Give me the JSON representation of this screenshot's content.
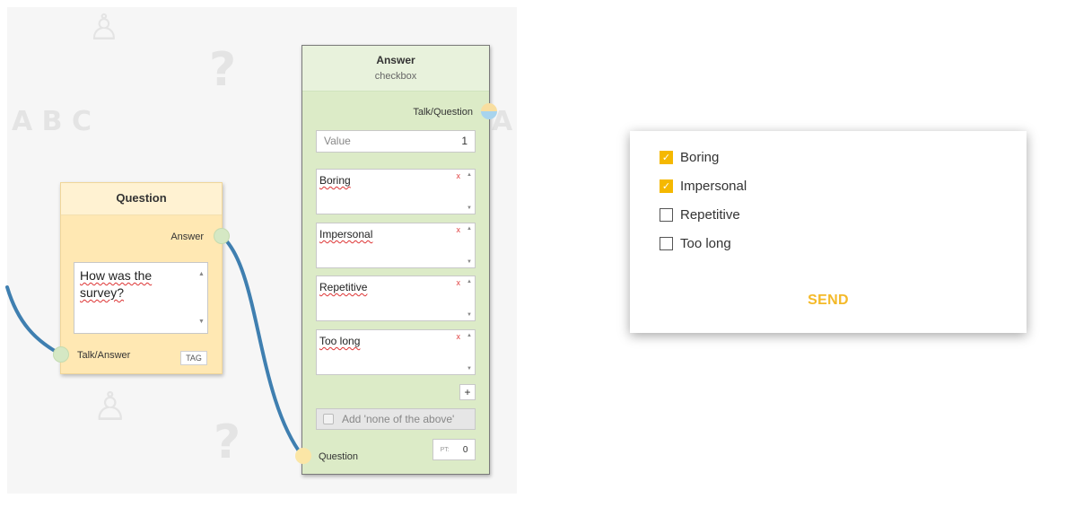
{
  "question_node": {
    "title": "Question",
    "output_port_label": "Answer",
    "question_text_line1": "How was the",
    "question_text_line2": "survey?",
    "input_port_label": "Talk/Answer",
    "tag_label": "TAG"
  },
  "answer_node": {
    "title": "Answer",
    "subtitle": "checkbox",
    "output_port_label": "Talk/Question",
    "value_placeholder": "Value",
    "value": "1",
    "options": [
      "Boring",
      "Impersonal",
      "Repetitive",
      "Too long"
    ],
    "remove_label": "x",
    "add_label": "+",
    "none_of_above_label": "Add 'none of the above'",
    "input_port_label": "Question",
    "pt_label": "PT:",
    "pt_value": "0"
  },
  "preview": {
    "choices": [
      {
        "label": "Boring",
        "checked": true
      },
      {
        "label": "Impersonal",
        "checked": true
      },
      {
        "label": "Repetitive",
        "checked": false
      },
      {
        "label": "Too long",
        "checked": false
      }
    ],
    "check_glyph": "✓",
    "send_label": "SEND"
  },
  "colors": {
    "question_node_bg": "#ffe8b3",
    "answer_node_bg": "#dcebc7",
    "accent": "#f5b800",
    "link": "#3f7fb0"
  }
}
